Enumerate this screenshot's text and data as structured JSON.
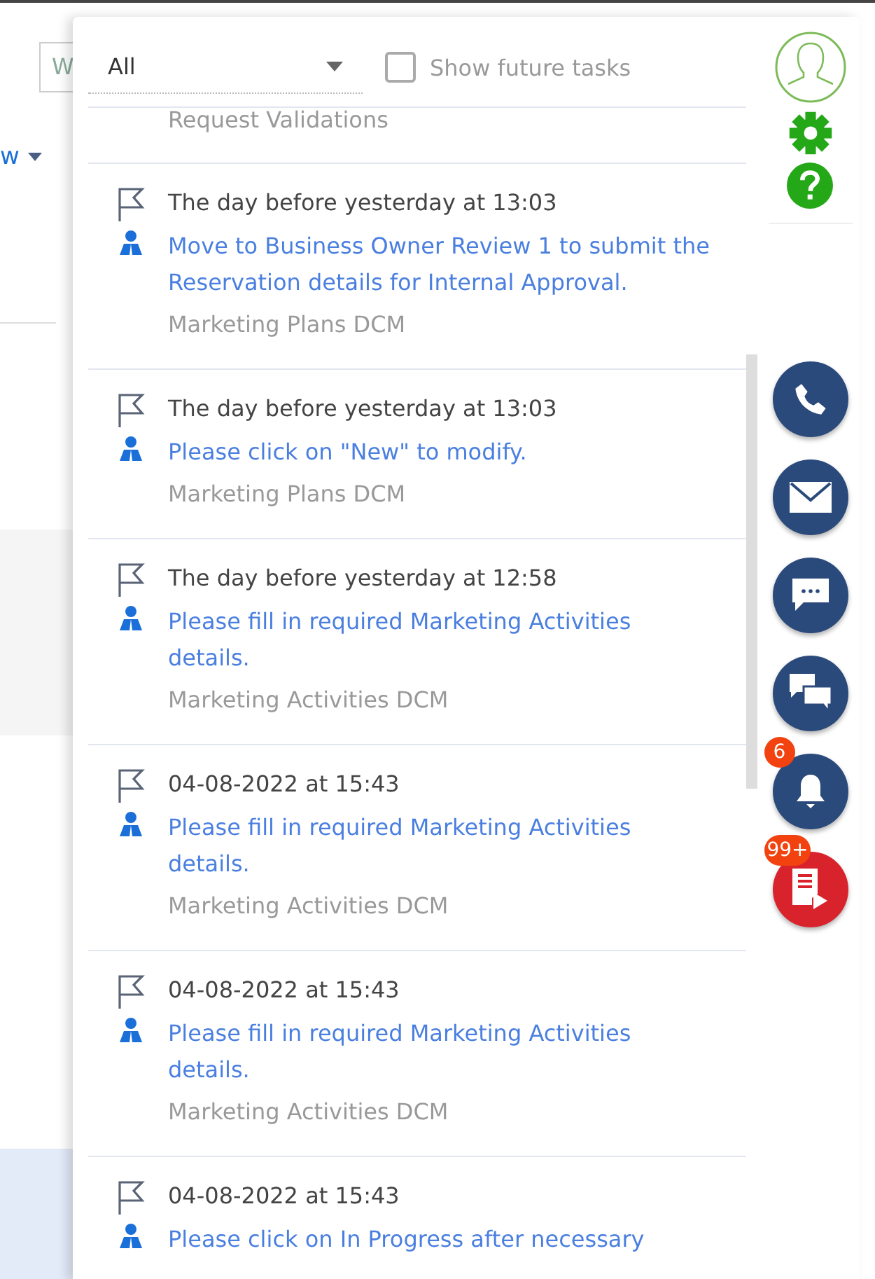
{
  "background": {
    "field_value": "W",
    "link": "w"
  },
  "filter": {
    "value": "All",
    "show_future_tasks": {
      "label": "Show future tasks",
      "checked": false
    }
  },
  "partial_task": {
    "source": "Request Validations"
  },
  "tasks": [
    {
      "date": "The day before yesterday at 13:03",
      "title": "Move to Business Owner Review 1 to submit the Reservation details for Internal Approval.",
      "source": "Marketing Plans DCM"
    },
    {
      "date": "The day before yesterday at 13:03",
      "title": "Please click on \"New\" to modify.",
      "source": "Marketing Plans DCM"
    },
    {
      "date": "The day before yesterday at 12:58",
      "title": "Please fill in required Marketing Activities details.",
      "source": "Marketing Activities DCM"
    },
    {
      "date": "04-08-2022 at 15:43",
      "title": "Please fill in required Marketing Activities details.",
      "source": "Marketing Activities DCM"
    },
    {
      "date": "04-08-2022 at 15:43",
      "title": "Please fill in required Marketing Activities details.",
      "source": "Marketing Activities DCM"
    },
    {
      "date": "04-08-2022 at 15:43",
      "title": "Please click on In Progress after necessary"
    }
  ],
  "rail": [
    {
      "kind": "phone"
    },
    {
      "kind": "mail"
    },
    {
      "kind": "chat"
    },
    {
      "kind": "chats"
    },
    {
      "kind": "bell",
      "badge": "6"
    },
    {
      "kind": "doc",
      "badge": "99+"
    }
  ]
}
